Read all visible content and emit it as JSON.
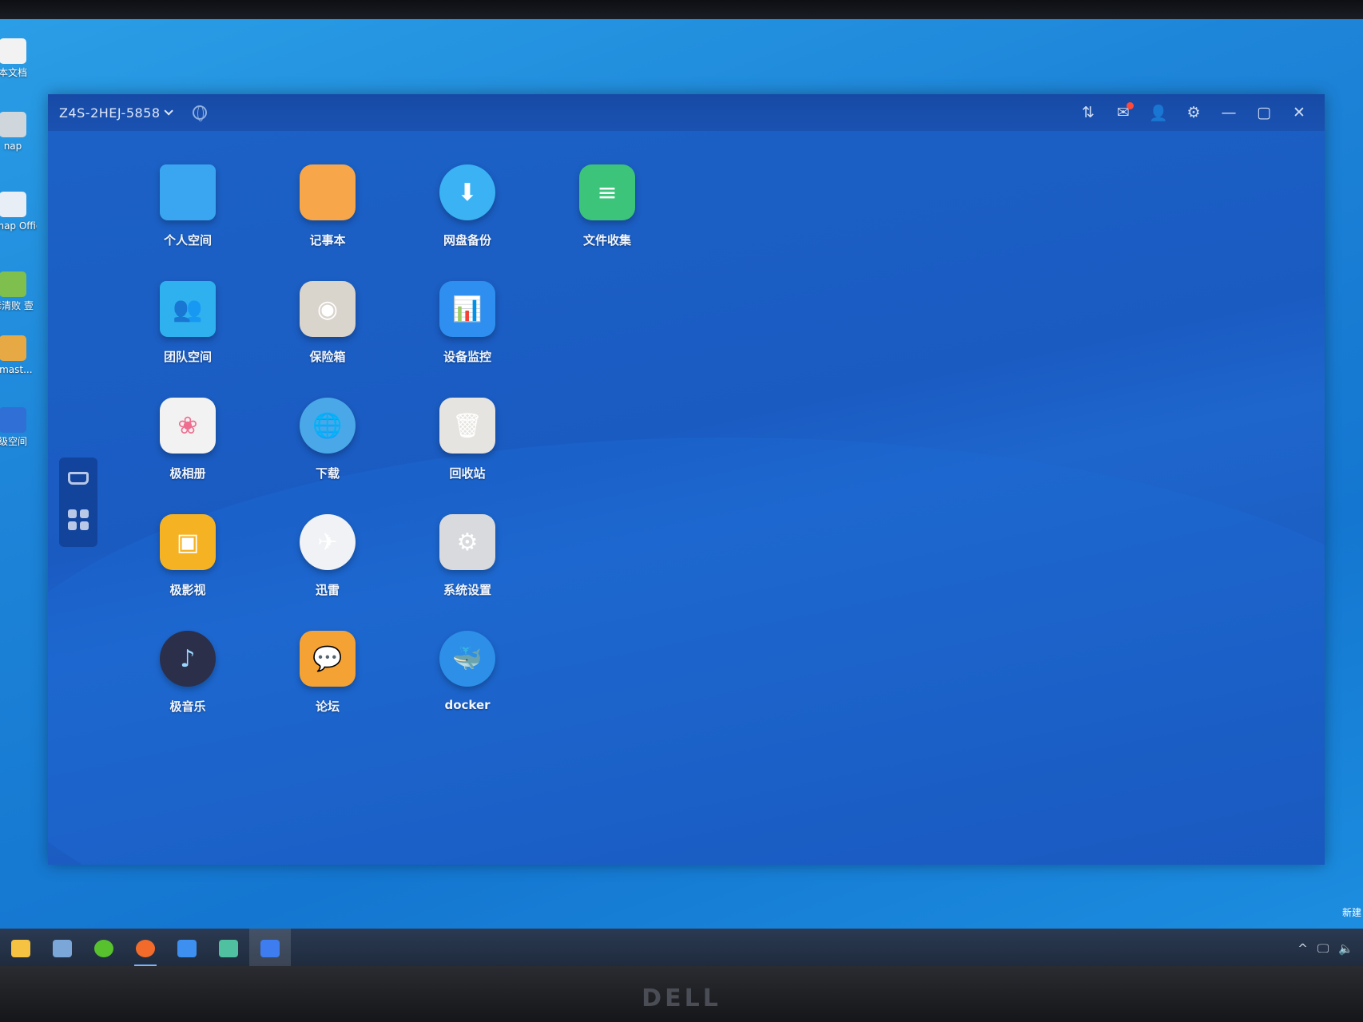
{
  "desktop": {
    "icons": [
      {
        "label": "本文档",
        "color": "#f2f2f2"
      },
      {
        "label": "nap",
        "color": "#cfd6dc"
      },
      {
        "label": "emap Office",
        "color": "#e8eef5"
      },
      {
        "label": "毒清败 壹",
        "color": "#7fbf4d"
      },
      {
        "label": "nmast...",
        "color": "#e7a943"
      },
      {
        "label": "级空间",
        "color": "#2f6fd6"
      }
    ],
    "right_edge_label": "新建"
  },
  "window": {
    "device_name": "Z4S-2HEJ-5858",
    "controls": [
      {
        "name": "transfer-icon",
        "glyph": "⇅"
      },
      {
        "name": "message-icon",
        "glyph": "✉"
      },
      {
        "name": "user-icon",
        "glyph": "👤"
      },
      {
        "name": "gear-icon",
        "glyph": "⚙"
      },
      {
        "name": "minimize-icon",
        "glyph": "—"
      },
      {
        "name": "maximize-icon",
        "glyph": "▢"
      },
      {
        "name": "close-icon",
        "glyph": "✕"
      }
    ]
  },
  "apps": [
    {
      "label": "个人空间",
      "color": "#3aa6f2",
      "glyph": ""
    },
    {
      "label": "记事本",
      "color": "#f7a64a",
      "glyph": ""
    },
    {
      "label": "网盘备份",
      "color": "#3ab2f4",
      "glyph": "⬇"
    },
    {
      "label": "文件收集",
      "color": "#3cc47a",
      "glyph": "≡"
    },
    {
      "label": "团队空间",
      "color": "#2fb0ef",
      "glyph": "👥"
    },
    {
      "label": "保险箱",
      "color": "#d9d4cc",
      "glyph": "◉"
    },
    {
      "label": "设备监控",
      "color": "#2e8ff0",
      "glyph": "📊"
    },
    {
      "label": "极相册",
      "color": "#f2f2f2",
      "glyph": "❀"
    },
    {
      "label": "下载",
      "color": "#4aa8e8",
      "glyph": "🌐"
    },
    {
      "label": "回收站",
      "color": "#e6e4e0",
      "glyph": "🗑"
    },
    {
      "label": "极影视",
      "color": "#f5b324",
      "glyph": "▣"
    },
    {
      "label": "迅雷",
      "color": "#f0f2f5",
      "glyph": "✈"
    },
    {
      "label": "系统设置",
      "color": "#d8dade",
      "glyph": "⚙"
    },
    {
      "label": "极音乐",
      "color": "#2b2f4a",
      "glyph": "♪"
    },
    {
      "label": "论坛",
      "color": "#f5a235",
      "glyph": "💬"
    },
    {
      "label": "docker",
      "color": "#2d8fe8",
      "glyph": "🐳"
    }
  ],
  "taskbar": {
    "items": [
      {
        "name": "file-explorer-icon",
        "color": "#f5c242"
      },
      {
        "name": "calculator-icon",
        "color": "#7aa6d8"
      },
      {
        "name": "green-app-icon",
        "color": "#57c22e"
      },
      {
        "name": "firefox-icon",
        "color": "#f36b2a"
      },
      {
        "name": "grid-app-icon",
        "color": "#3d8ff0"
      },
      {
        "name": "edit-app-icon",
        "color": "#4fc0a0"
      },
      {
        "name": "nas-app-icon",
        "color": "#3d7df0"
      }
    ],
    "tray": [
      "^",
      "🖵",
      "🔈"
    ]
  },
  "brand": "DELL"
}
